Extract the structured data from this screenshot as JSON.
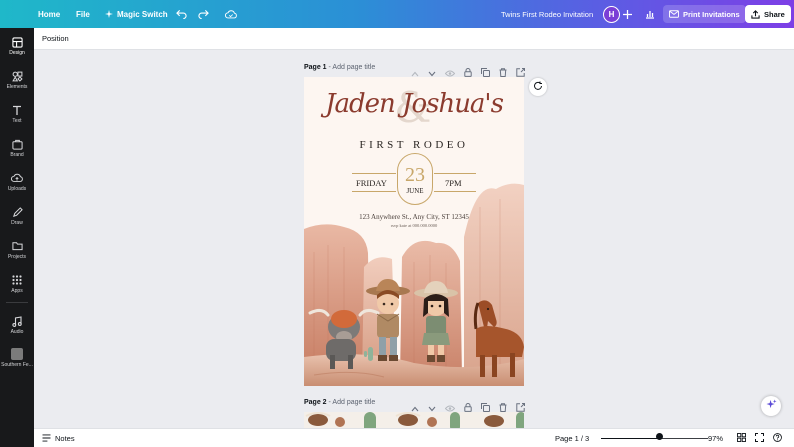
{
  "topbar": {
    "home": "Home",
    "file": "File",
    "magic_switch": "Magic Switch",
    "doc_title": "Twins First Rodeo Invitation",
    "avatar_initial": "H",
    "print_label": "Print Invitations",
    "share_label": "Share"
  },
  "rail": {
    "items": [
      {
        "label": "Design",
        "icon": "design-icon"
      },
      {
        "label": "Elements",
        "icon": "elements-icon"
      },
      {
        "label": "Text",
        "icon": "text-icon"
      },
      {
        "label": "Brand",
        "icon": "brand-icon"
      },
      {
        "label": "Uploads",
        "icon": "uploads-icon"
      },
      {
        "label": "Draw",
        "icon": "draw-icon"
      },
      {
        "label": "Projects",
        "icon": "projects-icon"
      },
      {
        "label": "Apps",
        "icon": "apps-icon"
      },
      {
        "label": "Audio",
        "icon": "audio-icon"
      },
      {
        "label": "Southern Fe...",
        "icon": "template-thumbnail"
      }
    ]
  },
  "context": {
    "position_label": "Position"
  },
  "pages": [
    {
      "label": "Page 1",
      "title_placeholder": "Add page title"
    },
    {
      "label": "Page 2",
      "title_placeholder": "Add page title"
    }
  ],
  "invite": {
    "names": "Jaden Joshua's",
    "ampersand": "&",
    "event": "FIRST RODEO",
    "day_name": "FRIDAY",
    "day_number": "23",
    "month": "JUNE",
    "time": "7PM",
    "address": "123 Anywhere St., Any City, ST 12345",
    "rsvp": "rsvp kate at 000.000.0000"
  },
  "bottombar": {
    "notes": "Notes",
    "page_indicator": "Page 1 / 3",
    "zoom": "97%",
    "zoom_fraction": 0.55
  },
  "colors": {
    "accent_gradient_start": "#1fb8c9",
    "accent_gradient_end": "#7d3fe6",
    "rail_bg": "#18191b",
    "invite_script": "#8b3b2e",
    "invite_gold": "#c8a76a"
  }
}
